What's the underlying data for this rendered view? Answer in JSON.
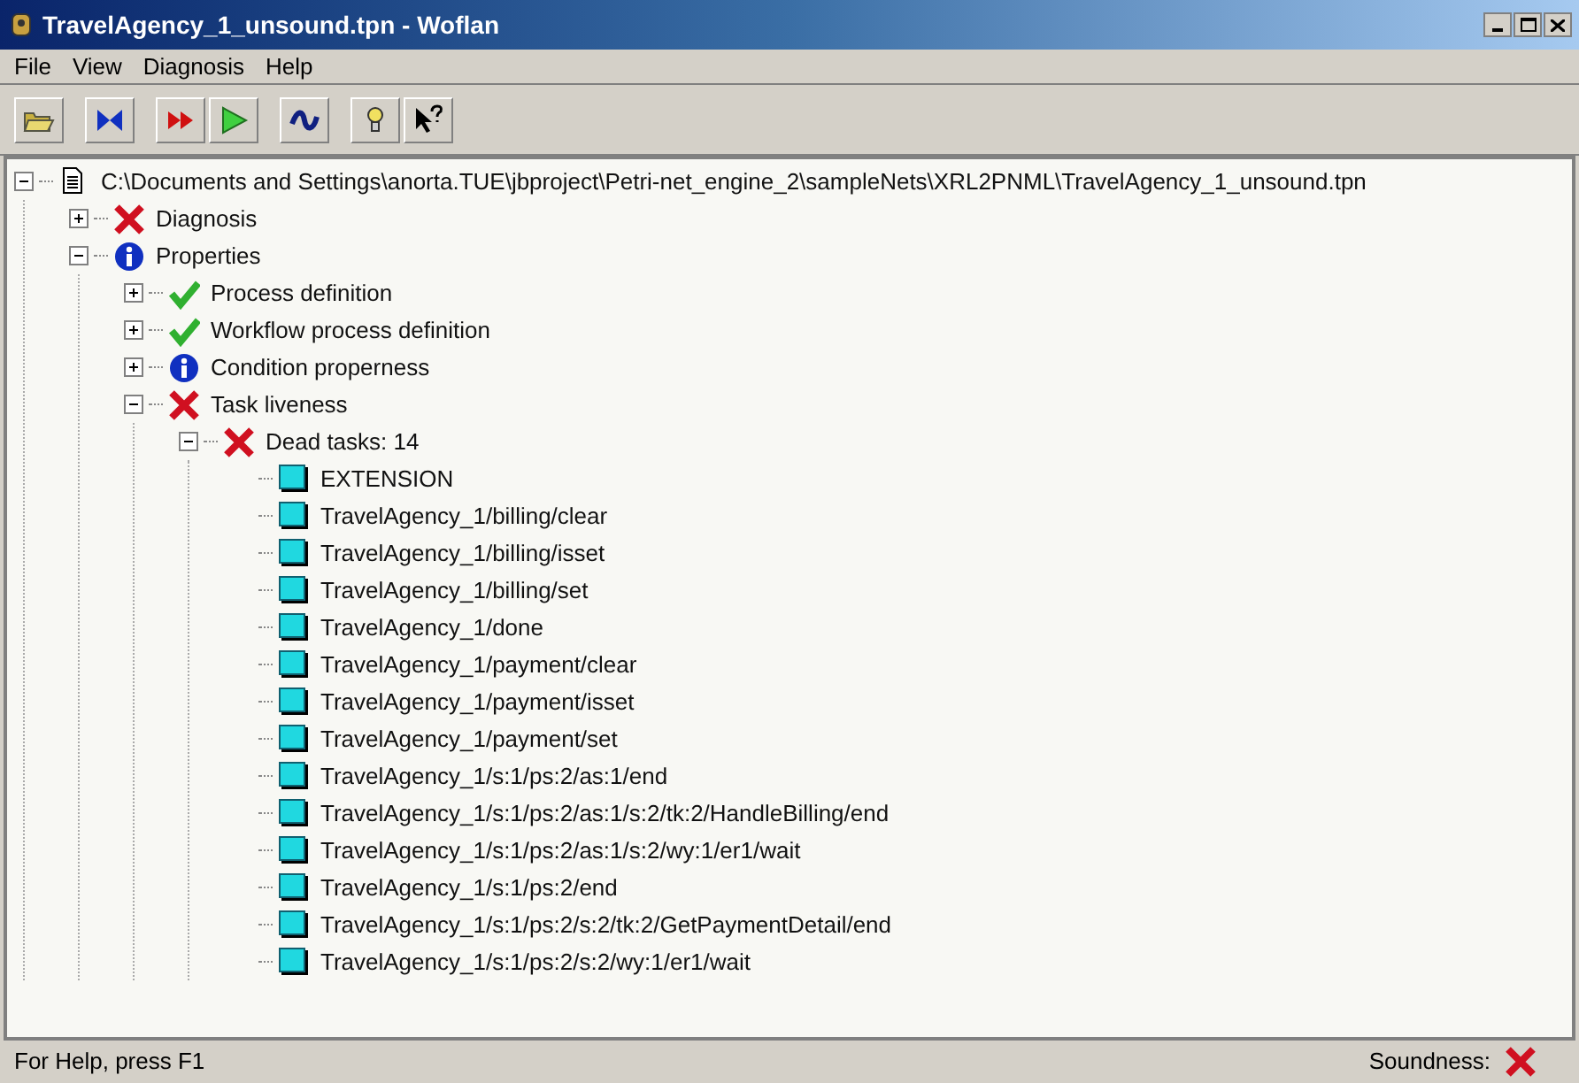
{
  "window": {
    "title": "TravelAgency_1_unsound.tpn - Woflan"
  },
  "menu": [
    "File",
    "View",
    "Diagnosis",
    "Help"
  ],
  "toolbar": [
    {
      "kind": "open"
    },
    {
      "kind": "bowtie"
    },
    {
      "kind": "fastforward"
    },
    {
      "kind": "play"
    },
    {
      "kind": "wave"
    },
    {
      "kind": "bulb"
    },
    {
      "kind": "helppointer"
    }
  ],
  "tree": [
    {
      "label": "C:\\Documents and Settings\\anorta.TUE\\jbproject\\Petri-net_engine_2\\sampleNets\\XRL2PNML\\TravelAgency_1_unsound.tpn",
      "kind": "file",
      "expanded": true,
      "children": [
        {
          "label": "Diagnosis",
          "kind": "error",
          "expanded": false
        },
        {
          "label": "Properties",
          "kind": "info",
          "expanded": true,
          "children": [
            {
              "label": "Process definition",
              "kind": "ok",
              "expanded": false
            },
            {
              "label": "Workflow process definition",
              "kind": "ok",
              "expanded": false
            },
            {
              "label": "Condition properness",
              "kind": "info",
              "expanded": false
            },
            {
              "label": "Task liveness",
              "kind": "error",
              "expanded": true,
              "children": [
                {
                  "label": "Dead tasks: 14",
                  "kind": "error",
                  "expanded": true,
                  "children": [
                    {
                      "label": "EXTENSION",
                      "kind": "task"
                    },
                    {
                      "label": "TravelAgency_1/billing/clear",
                      "kind": "task"
                    },
                    {
                      "label": "TravelAgency_1/billing/isset",
                      "kind": "task"
                    },
                    {
                      "label": "TravelAgency_1/billing/set",
                      "kind": "task"
                    },
                    {
                      "label": "TravelAgency_1/done",
                      "kind": "task"
                    },
                    {
                      "label": "TravelAgency_1/payment/clear",
                      "kind": "task"
                    },
                    {
                      "label": "TravelAgency_1/payment/isset",
                      "kind": "task"
                    },
                    {
                      "label": "TravelAgency_1/payment/set",
                      "kind": "task"
                    },
                    {
                      "label": "TravelAgency_1/s:1/ps:2/as:1/end",
                      "kind": "task"
                    },
                    {
                      "label": "TravelAgency_1/s:1/ps:2/as:1/s:2/tk:2/HandleBilling/end",
                      "kind": "task"
                    },
                    {
                      "label": "TravelAgency_1/s:1/ps:2/as:1/s:2/wy:1/er1/wait",
                      "kind": "task"
                    },
                    {
                      "label": "TravelAgency_1/s:1/ps:2/end",
                      "kind": "task"
                    },
                    {
                      "label": "TravelAgency_1/s:1/ps:2/s:2/tk:2/GetPaymentDetail/end",
                      "kind": "task"
                    },
                    {
                      "label": "TravelAgency_1/s:1/ps:2/s:2/wy:1/er1/wait",
                      "kind": "task"
                    }
                  ]
                }
              ]
            }
          ]
        }
      ]
    }
  ],
  "status_bar": {
    "help": "For Help, press F1",
    "soundness_label": "Soundness:",
    "sound": false
  }
}
